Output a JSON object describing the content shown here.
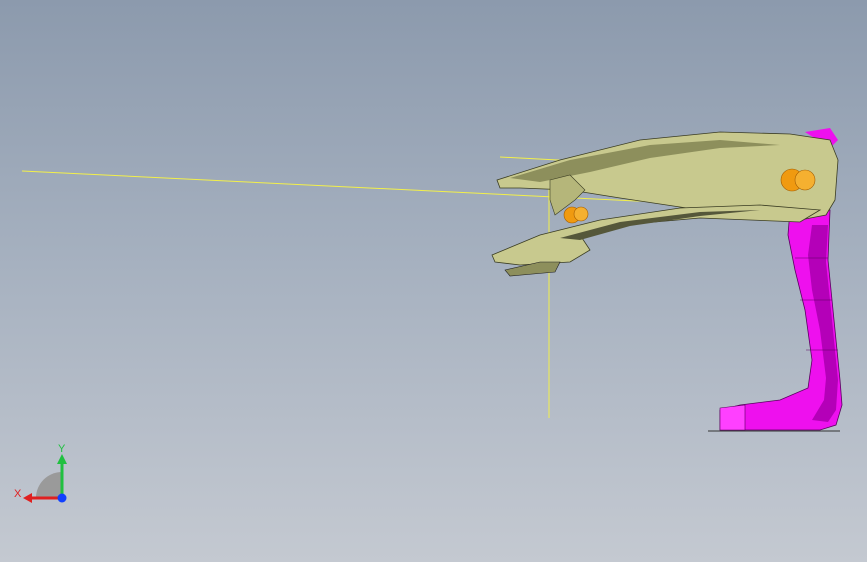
{
  "viewport": {
    "background_top": "#8c9aad",
    "background_bottom": "#c4c9d1"
  },
  "model": {
    "body_color": "#c8c98e",
    "body_shadow": "#8d8f5c",
    "pink_color": "#ee10ee",
    "pink_shadow": "#b400b8",
    "feature_color": "#f09a10",
    "sketch_color": "#f3f04a"
  },
  "triad": {
    "x_label": "X",
    "y_label": "Y",
    "x_color": "#e02020",
    "y_color": "#20c040",
    "z_color": "#1040ff"
  }
}
